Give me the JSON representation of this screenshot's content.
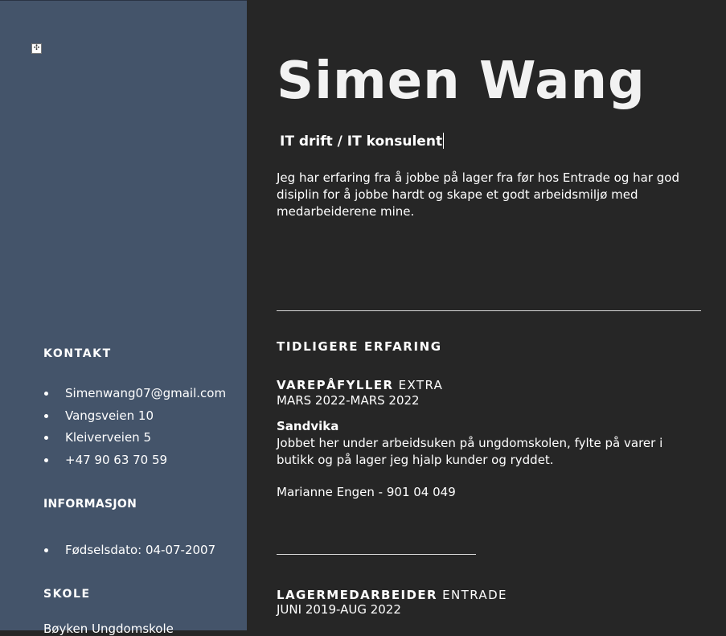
{
  "sidebar": {
    "move_handle_glyph": "✣",
    "contact": {
      "heading": "KONTAKT",
      "items": [
        "Simenwang07@gmail.com",
        "Vangsveien 10",
        "Kleiverveien 5",
        "+47 90 63 70 59"
      ]
    },
    "info": {
      "heading": "INFORMASJON",
      "items": [
        "Fødselsdato: 04-07-2007"
      ]
    },
    "school": {
      "heading": "SKOLE",
      "first_line": "Bøyken Ungdomskole"
    }
  },
  "main": {
    "name": "Simen Wang",
    "title": "IT drift / IT konsulent",
    "summary": "Jeg har erfaring fra å jobbe på lager fra før hos Entrade og har god disiplin for å jobbe hardt og skape et godt arbeidsmiljø med medarbeiderene mine.",
    "experience_heading": "TIDLIGERE ERFARING",
    "jobs": [
      {
        "role": "VAREPÅFYLLER",
        "company": "EXTRA",
        "dates": "MARS 2022-MARS 2022",
        "place": "Sandvika",
        "description": "Jobbet her under arbeidsuken på ungdomskolen, fylte på varer i butikk og på lager jeg hjalp kunder og ryddet.",
        "reference": "Marianne Engen - 901 04 049"
      },
      {
        "role": "LAGERMEDARBEIDER",
        "company": "ENTRADE",
        "dates": "JUNI 2019-AUG 2022"
      }
    ]
  },
  "colors": {
    "sidebar_bg": "#44546a",
    "main_bg": "#262626",
    "text": "#ffffff"
  }
}
